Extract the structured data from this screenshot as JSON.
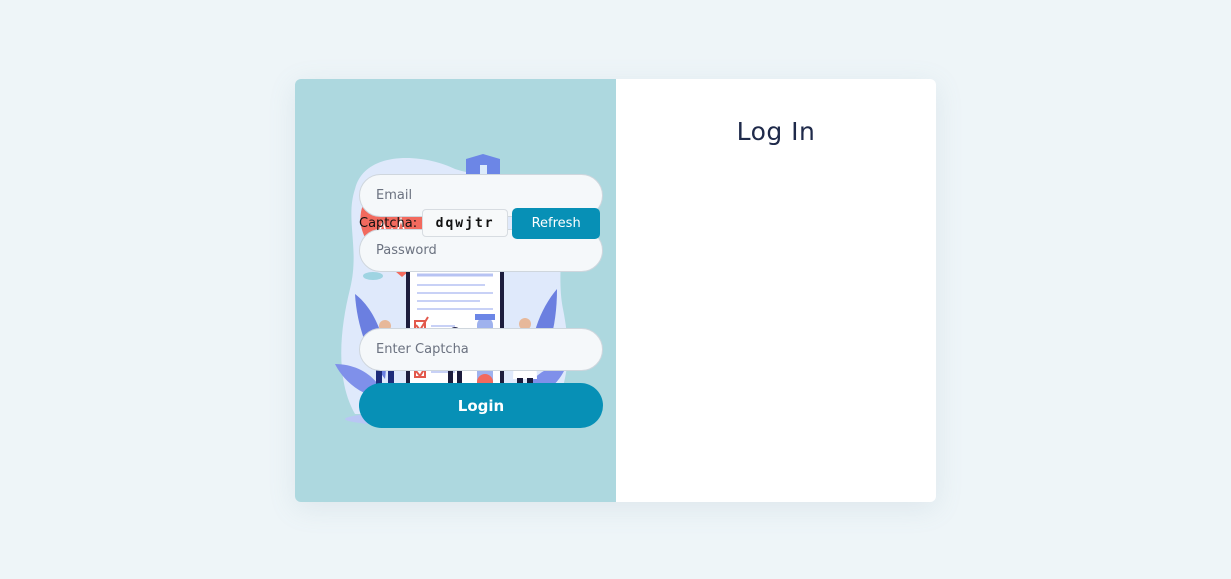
{
  "login": {
    "title": "Log In",
    "email_placeholder": "Email",
    "password_placeholder": "Password",
    "captcha_label": "Captcha:",
    "captcha_code": "dqwjtr",
    "refresh_label": "Refresh",
    "captcha_placeholder": "Enter Captcha",
    "login_label": "Login"
  },
  "colors": {
    "page_bg": "#eef5f8",
    "illustration_bg": "#add8df",
    "accent": "#0790b6",
    "title": "#1f2a4a"
  },
  "illustration": {
    "icons": [
      "heart-icon",
      "shield-cross-icon",
      "clipboard-icon",
      "test-tube-icon"
    ]
  }
}
